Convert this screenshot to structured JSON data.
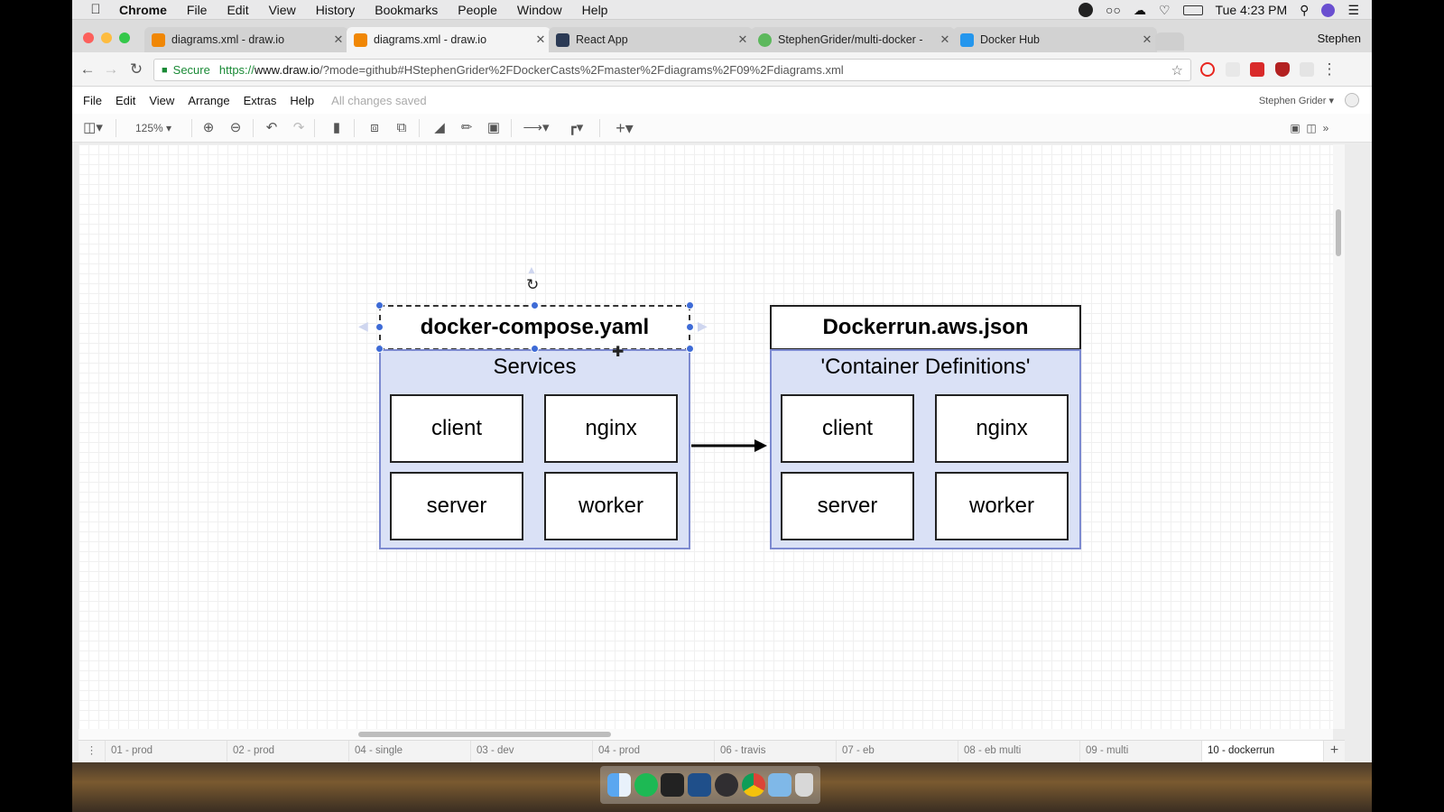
{
  "menubar": {
    "items": [
      "Chrome",
      "File",
      "Edit",
      "View",
      "History",
      "Bookmarks",
      "People",
      "Window",
      "Help"
    ],
    "clock": "Tue 4:23 PM"
  },
  "tabs": [
    {
      "title": "diagrams.xml - draw.io",
      "active": false,
      "favicon_color": "#f08705"
    },
    {
      "title": "diagrams.xml - draw.io",
      "active": true,
      "favicon_color": "#f08705"
    },
    {
      "title": "React App",
      "active": false,
      "favicon_color": "#2b3a55"
    },
    {
      "title": "StephenGrider/multi-docker -",
      "active": false,
      "favicon_color": "#5cb85c"
    },
    {
      "title": "Docker Hub",
      "active": false,
      "favicon_color": "#2496ed"
    }
  ],
  "profile_name": "Stephen",
  "address": {
    "secure_label": "Secure",
    "url_prefix": "https://",
    "url_host": "www.draw.io",
    "url_rest": "/?mode=github#HStephenGrider%2FDockerCasts%2Fmaster%2Fdiagrams%2F09%2Fdiagrams.xml"
  },
  "drawio_menu": {
    "items": [
      "File",
      "Edit",
      "View",
      "Arrange",
      "Extras",
      "Help"
    ],
    "status": "All changes saved",
    "user": "Stephen Grider"
  },
  "toolbar": {
    "zoom": "125%"
  },
  "diagram": {
    "left": {
      "title": "docker-compose.yaml",
      "subtitle": "Services",
      "items": [
        "client",
        "nginx",
        "server",
        "worker"
      ]
    },
    "right": {
      "title": "Dockerrun.aws.json",
      "subtitle": "'Container Definitions'",
      "items": [
        "client",
        "nginx",
        "server",
        "worker"
      ]
    }
  },
  "pages": [
    "01 - prod",
    "02 - prod",
    "04 - single",
    "03 - dev",
    "04 - prod",
    "06 - travis",
    "07 - eb",
    "08 - eb multi",
    "09 - multi",
    "10 - dockerrun"
  ],
  "active_page": "10 - dockerrun",
  "colors": {
    "container_fill": "#dae1f6",
    "container_stroke": "#7d8ad0",
    "selection_handle": "#3e6bd6"
  }
}
